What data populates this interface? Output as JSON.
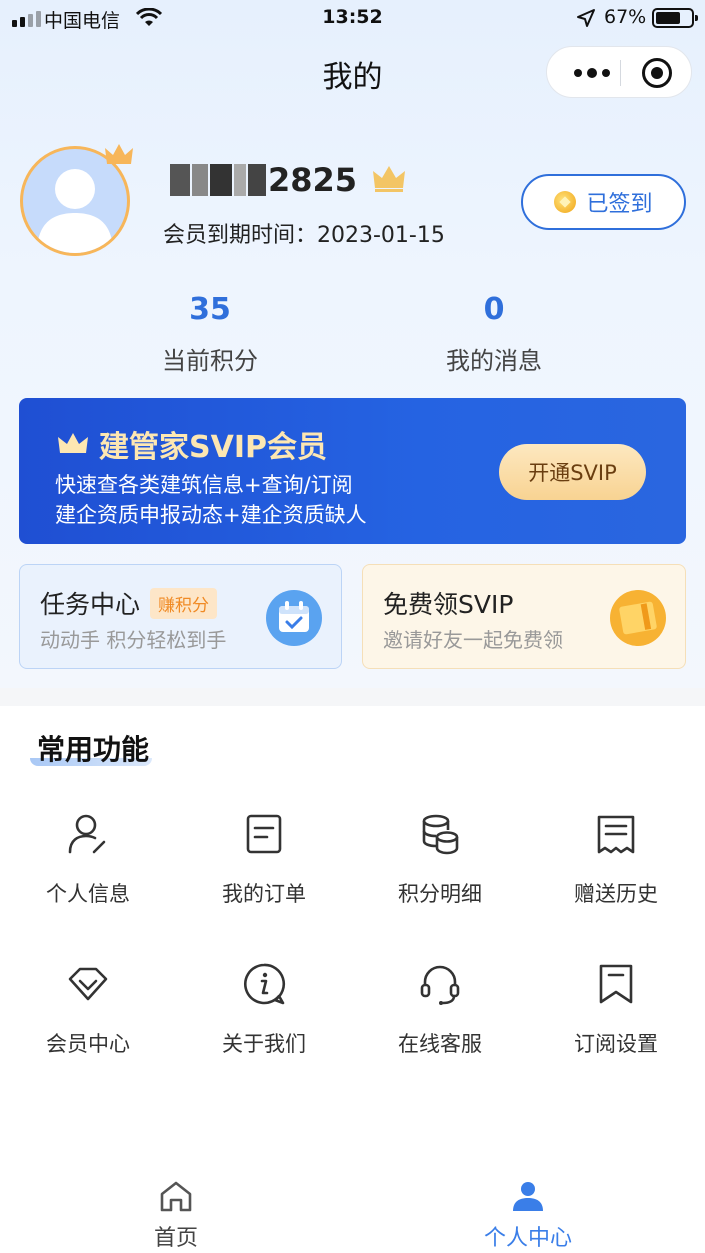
{
  "status_bar": {
    "carrier": "中国电信",
    "time": "13:52",
    "battery": "67%"
  },
  "nav": {
    "title": "我的"
  },
  "profile": {
    "username_visible": "2825",
    "expire_label": "会员到期时间：2023-01-15",
    "checkin_label": "已签到"
  },
  "stats": [
    {
      "value": "35",
      "label": "当前积分"
    },
    {
      "value": "0",
      "label": "我的消息"
    }
  ],
  "svip": {
    "title": "建管家SVIP会员",
    "line1": "快速查各类建筑信息+查询/订阅",
    "line2": "建企资质申报动态+建企资质缺人",
    "button": "开通SVIP"
  },
  "cards": {
    "task": {
      "title": "任务中心",
      "badge": "赚积分",
      "subtitle": "动动手 积分轻松到手"
    },
    "free": {
      "title": "免费领SVIP",
      "subtitle": "邀请好友一起免费领"
    }
  },
  "section": {
    "title": "常用功能"
  },
  "functions": [
    {
      "label": "个人信息",
      "icon": "user-icon"
    },
    {
      "label": "我的订单",
      "icon": "order-icon"
    },
    {
      "label": "积分明细",
      "icon": "coins-stack-icon"
    },
    {
      "label": "赠送历史",
      "icon": "receipt-icon"
    },
    {
      "label": "会员中心",
      "icon": "diamond-icon"
    },
    {
      "label": "关于我们",
      "icon": "info-icon"
    },
    {
      "label": "在线客服",
      "icon": "headset-icon"
    },
    {
      "label": "订阅设置",
      "icon": "bookmark-icon"
    }
  ],
  "tabbar": {
    "home": "首页",
    "me": "个人中心"
  },
  "colors": {
    "accent": "#2f6fdb",
    "svip_gradient_start": "#1f4fd3",
    "gold": "#f7b65a",
    "tab_active": "#3a7ee8"
  }
}
